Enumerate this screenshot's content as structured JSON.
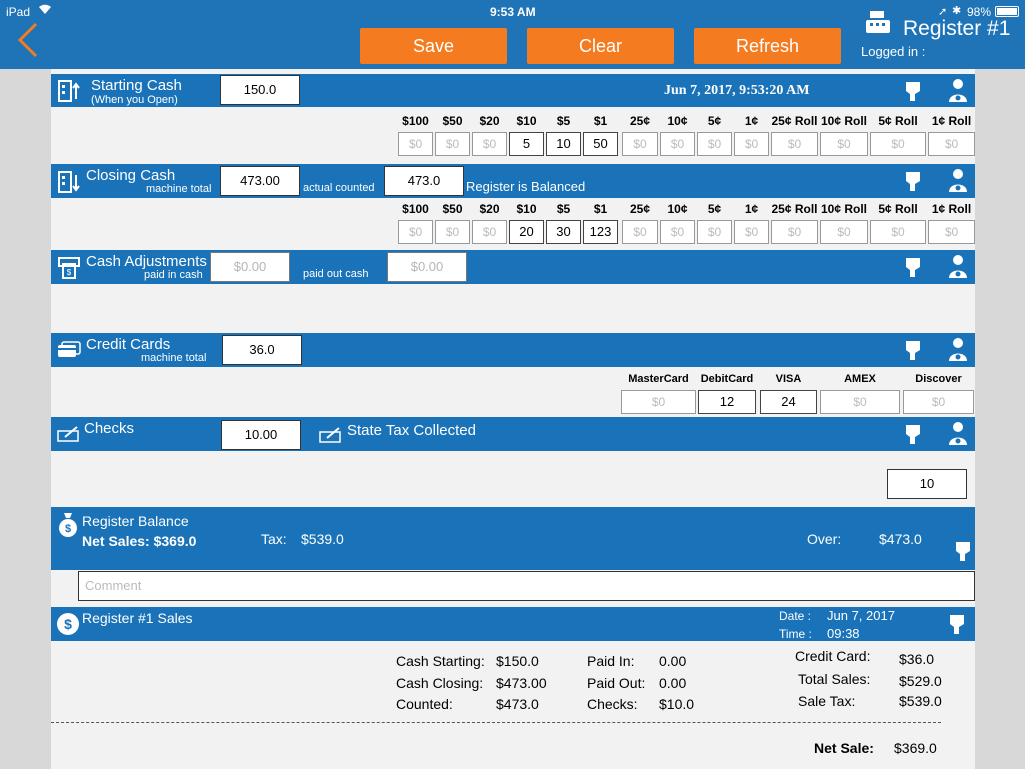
{
  "status": {
    "device": "iPad",
    "time": "9:53 AM",
    "battery": "98%"
  },
  "header": {
    "title": "Register #1",
    "logged_in": "Logged in :"
  },
  "toolbar": {
    "save": "Save",
    "clear": "Clear",
    "refresh": "Refresh"
  },
  "starting": {
    "title": "Starting Cash",
    "subtitle": "(When you Open)",
    "value": "150.0",
    "datetime": "Jun 7, 2017, 9:53:20 AM"
  },
  "denoms": [
    "$100",
    "$50",
    "$20",
    "$10",
    "$5",
    "$1",
    "25¢",
    "10¢",
    "5¢",
    "1¢",
    "25¢ Roll",
    "10¢ Roll",
    "5¢ Roll",
    "1¢ Roll"
  ],
  "starting_counts": [
    "$0",
    "$0",
    "$0",
    "5",
    "10",
    "50",
    "$0",
    "$0",
    "$0",
    "$0",
    "$0",
    "$0",
    "$0",
    "$0"
  ],
  "closing": {
    "title": "Closing Cash",
    "machine_label": "machine total",
    "machine_value": "473.00",
    "counted_label": "actual counted",
    "counted_value": "473.0",
    "status": "Register is Balanced"
  },
  "closing_counts": [
    "$0",
    "$0",
    "$0",
    "20",
    "30",
    "123",
    "$0",
    "$0",
    "$0",
    "$0",
    "$0",
    "$0",
    "$0",
    "$0"
  ],
  "adjust": {
    "title": "Cash Adjustments",
    "paid_in_label": "paid in cash",
    "paid_in": "$0.00",
    "paid_out_label": "paid out cash",
    "paid_out": "$0.00"
  },
  "credit": {
    "title": "Credit Cards",
    "machine_label": "machine total",
    "value": "36.0",
    "cards": [
      "MasterCard",
      "DebitCard",
      "VISA",
      "AMEX",
      "Discover"
    ],
    "card_values": [
      "$0",
      "12",
      "24",
      "$0",
      "$0"
    ]
  },
  "checks": {
    "title": "Checks",
    "value": "10.00",
    "tax_title": "State Tax Collected",
    "tax_value": "10"
  },
  "balance": {
    "title": "Register Balance",
    "net_sales": "Net Sales: $369.0",
    "tax_label": "Tax:",
    "tax_value": "$539.0",
    "over_label": "Over:",
    "over_value": "$473.0"
  },
  "comment": {
    "placeholder": "Comment"
  },
  "sales": {
    "title": "Register #1 Sales",
    "date_label": "Date :",
    "date_value": "Jun 7, 2017",
    "time_label": "Time :",
    "time_value": "09:38",
    "cash_starting_label": "Cash Starting:",
    "cash_starting": "$150.0",
    "cash_closing_label": "Cash Closing:",
    "cash_closing": "$473.00",
    "counted_label": "Counted:",
    "counted": "$473.0",
    "paid_in_label": "Paid In:",
    "paid_in": "0.00",
    "paid_out_label": "Paid Out:",
    "paid_out": "0.00",
    "checks_label": "Checks:",
    "checks": "$10.0",
    "credit_card_label": "Credit Card:",
    "credit_card": "$36.0",
    "total_sales_label": "Total Sales:",
    "total_sales": "$529.0",
    "sale_tax_label": "Sale Tax:",
    "sale_tax": "$539.0",
    "net_sale_label": "Net Sale:",
    "net_sale": "$369.0"
  }
}
